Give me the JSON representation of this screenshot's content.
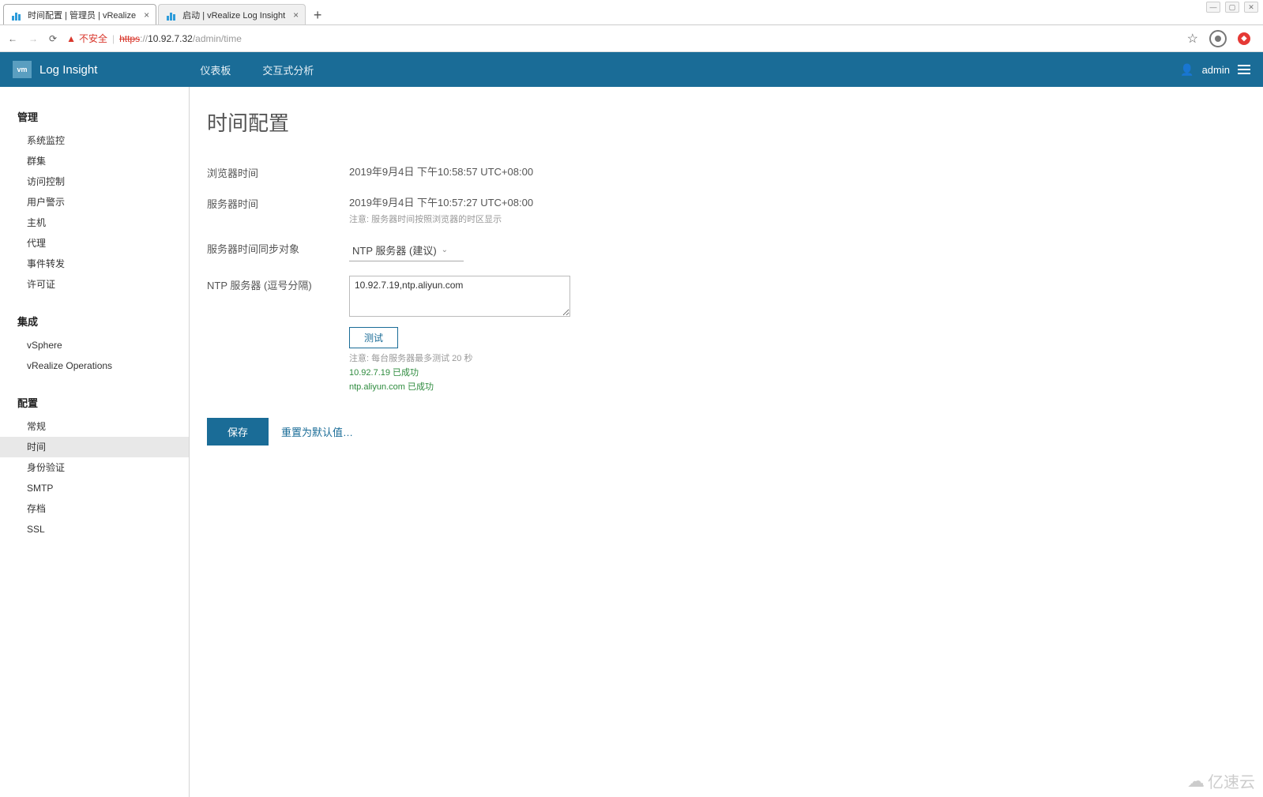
{
  "window": {
    "minimize": "_",
    "maximize": "▢",
    "close": "✕"
  },
  "tabs": [
    {
      "title": "时间配置 | 管理员 | vRealize"
    },
    {
      "title": "启动 | vRealize Log Insight"
    }
  ],
  "addressbar": {
    "insecure_label": "不安全",
    "url_scheme": "https",
    "url_sep": "://",
    "url_host": "10.92.7.32",
    "url_path": "/admin/time"
  },
  "app": {
    "logo": "vm",
    "brand": "Log Insight",
    "nav": {
      "dashboard": "仪表板",
      "interactive": "交互式分析"
    },
    "user": "admin"
  },
  "sidebar": {
    "section1_title": "管理",
    "section1": {
      "sys_monitor": "系统监控",
      "cluster": "群集",
      "access_ctrl": "访问控制",
      "user_alerts": "用户警示",
      "hosts": "主机",
      "agents": "代理",
      "event_fwd": "事件转发",
      "license": "许可证"
    },
    "section2_title": "集成",
    "section2": {
      "vsphere": "vSphere",
      "vrops": "vRealize Operations"
    },
    "section3_title": "配置",
    "section3": {
      "general": "常规",
      "time": "时间",
      "auth": "身份验证",
      "smtp": "SMTP",
      "archive": "存档",
      "ssl": "SSL"
    }
  },
  "page": {
    "title": "时间配置",
    "browser_time_label": "浏览器时间",
    "browser_time_value": "2019年9月4日 下午10:58:57 UTC+08:00",
    "server_time_label": "服务器时间",
    "server_time_value": "2019年9月4日 下午10:57:27 UTC+08:00",
    "server_time_note": "注意: 服务器时间按照浏览器的时区显示",
    "sync_label": "服务器时间同步对象",
    "sync_option": "NTP 服务器 (建议)",
    "ntp_label": "NTP 服务器 (逗号分隔)",
    "ntp_value": "10.92.7.19,ntp.aliyun.com",
    "test_button": "测试",
    "test_note": "注意: 每台服务器最多测试 20 秒",
    "result1": "10.92.7.19 已成功",
    "result2": "ntp.aliyun.com 已成功",
    "save": "保存",
    "reset": "重置为默认值…"
  },
  "watermark": "亿速云"
}
